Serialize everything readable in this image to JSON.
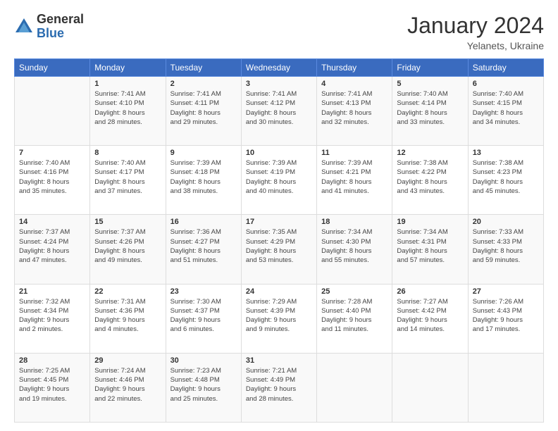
{
  "logo": {
    "general": "General",
    "blue": "Blue"
  },
  "header": {
    "month": "January 2024",
    "location": "Yelanets, Ukraine"
  },
  "days_of_week": [
    "Sunday",
    "Monday",
    "Tuesday",
    "Wednesday",
    "Thursday",
    "Friday",
    "Saturday"
  ],
  "weeks": [
    [
      {
        "day": "",
        "info": ""
      },
      {
        "day": "1",
        "info": "Sunrise: 7:41 AM\nSunset: 4:10 PM\nDaylight: 8 hours\nand 28 minutes."
      },
      {
        "day": "2",
        "info": "Sunrise: 7:41 AM\nSunset: 4:11 PM\nDaylight: 8 hours\nand 29 minutes."
      },
      {
        "day": "3",
        "info": "Sunrise: 7:41 AM\nSunset: 4:12 PM\nDaylight: 8 hours\nand 30 minutes."
      },
      {
        "day": "4",
        "info": "Sunrise: 7:41 AM\nSunset: 4:13 PM\nDaylight: 8 hours\nand 32 minutes."
      },
      {
        "day": "5",
        "info": "Sunrise: 7:40 AM\nSunset: 4:14 PM\nDaylight: 8 hours\nand 33 minutes."
      },
      {
        "day": "6",
        "info": "Sunrise: 7:40 AM\nSunset: 4:15 PM\nDaylight: 8 hours\nand 34 minutes."
      }
    ],
    [
      {
        "day": "7",
        "info": "Sunrise: 7:40 AM\nSunset: 4:16 PM\nDaylight: 8 hours\nand 35 minutes."
      },
      {
        "day": "8",
        "info": "Sunrise: 7:40 AM\nSunset: 4:17 PM\nDaylight: 8 hours\nand 37 minutes."
      },
      {
        "day": "9",
        "info": "Sunrise: 7:39 AM\nSunset: 4:18 PM\nDaylight: 8 hours\nand 38 minutes."
      },
      {
        "day": "10",
        "info": "Sunrise: 7:39 AM\nSunset: 4:19 PM\nDaylight: 8 hours\nand 40 minutes."
      },
      {
        "day": "11",
        "info": "Sunrise: 7:39 AM\nSunset: 4:21 PM\nDaylight: 8 hours\nand 41 minutes."
      },
      {
        "day": "12",
        "info": "Sunrise: 7:38 AM\nSunset: 4:22 PM\nDaylight: 8 hours\nand 43 minutes."
      },
      {
        "day": "13",
        "info": "Sunrise: 7:38 AM\nSunset: 4:23 PM\nDaylight: 8 hours\nand 45 minutes."
      }
    ],
    [
      {
        "day": "14",
        "info": "Sunrise: 7:37 AM\nSunset: 4:24 PM\nDaylight: 8 hours\nand 47 minutes."
      },
      {
        "day": "15",
        "info": "Sunrise: 7:37 AM\nSunset: 4:26 PM\nDaylight: 8 hours\nand 49 minutes."
      },
      {
        "day": "16",
        "info": "Sunrise: 7:36 AM\nSunset: 4:27 PM\nDaylight: 8 hours\nand 51 minutes."
      },
      {
        "day": "17",
        "info": "Sunrise: 7:35 AM\nSunset: 4:29 PM\nDaylight: 8 hours\nand 53 minutes."
      },
      {
        "day": "18",
        "info": "Sunrise: 7:34 AM\nSunset: 4:30 PM\nDaylight: 8 hours\nand 55 minutes."
      },
      {
        "day": "19",
        "info": "Sunrise: 7:34 AM\nSunset: 4:31 PM\nDaylight: 8 hours\nand 57 minutes."
      },
      {
        "day": "20",
        "info": "Sunrise: 7:33 AM\nSunset: 4:33 PM\nDaylight: 8 hours\nand 59 minutes."
      }
    ],
    [
      {
        "day": "21",
        "info": "Sunrise: 7:32 AM\nSunset: 4:34 PM\nDaylight: 9 hours\nand 2 minutes."
      },
      {
        "day": "22",
        "info": "Sunrise: 7:31 AM\nSunset: 4:36 PM\nDaylight: 9 hours\nand 4 minutes."
      },
      {
        "day": "23",
        "info": "Sunrise: 7:30 AM\nSunset: 4:37 PM\nDaylight: 9 hours\nand 6 minutes."
      },
      {
        "day": "24",
        "info": "Sunrise: 7:29 AM\nSunset: 4:39 PM\nDaylight: 9 hours\nand 9 minutes."
      },
      {
        "day": "25",
        "info": "Sunrise: 7:28 AM\nSunset: 4:40 PM\nDaylight: 9 hours\nand 11 minutes."
      },
      {
        "day": "26",
        "info": "Sunrise: 7:27 AM\nSunset: 4:42 PM\nDaylight: 9 hours\nand 14 minutes."
      },
      {
        "day": "27",
        "info": "Sunrise: 7:26 AM\nSunset: 4:43 PM\nDaylight: 9 hours\nand 17 minutes."
      }
    ],
    [
      {
        "day": "28",
        "info": "Sunrise: 7:25 AM\nSunset: 4:45 PM\nDaylight: 9 hours\nand 19 minutes."
      },
      {
        "day": "29",
        "info": "Sunrise: 7:24 AM\nSunset: 4:46 PM\nDaylight: 9 hours\nand 22 minutes."
      },
      {
        "day": "30",
        "info": "Sunrise: 7:23 AM\nSunset: 4:48 PM\nDaylight: 9 hours\nand 25 minutes."
      },
      {
        "day": "31",
        "info": "Sunrise: 7:21 AM\nSunset: 4:49 PM\nDaylight: 9 hours\nand 28 minutes."
      },
      {
        "day": "",
        "info": ""
      },
      {
        "day": "",
        "info": ""
      },
      {
        "day": "",
        "info": ""
      }
    ]
  ]
}
